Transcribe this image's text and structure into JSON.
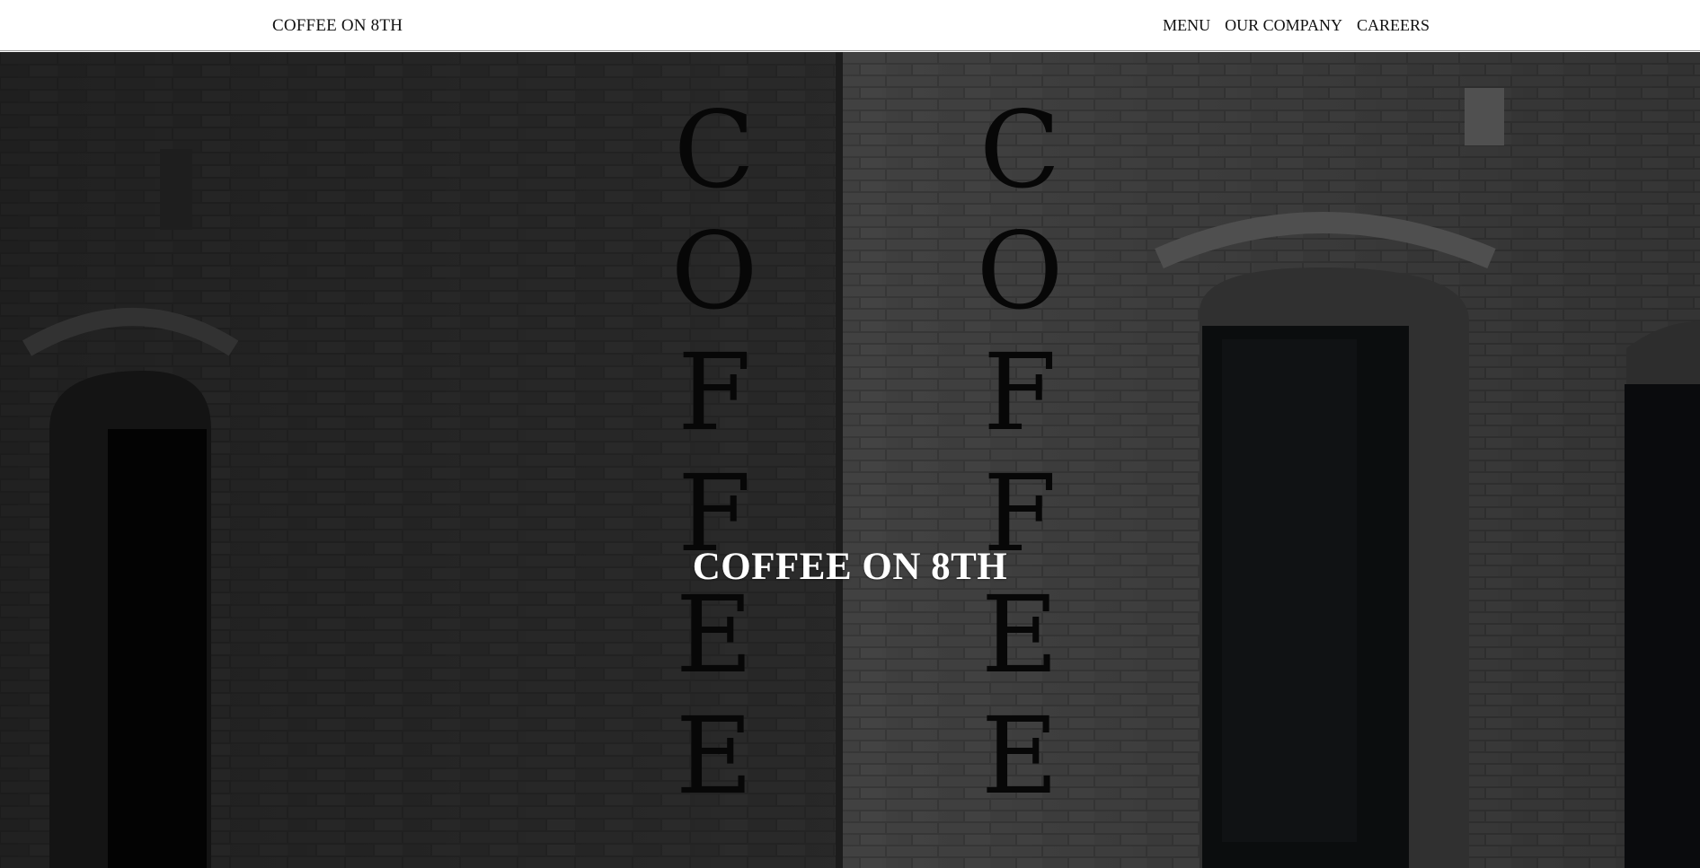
{
  "header": {
    "brand": "COFFEE ON 8TH",
    "nav": [
      {
        "label": "MENU"
      },
      {
        "label": "OUR COMPANY"
      },
      {
        "label": "CAREERS"
      }
    ]
  },
  "hero": {
    "title": "COFFEE ON 8TH",
    "background_image": "brick-building-corner-coffee-sign",
    "overlay": "dark"
  },
  "colors": {
    "header_bg": "#ffffff",
    "text_dark": "#111111",
    "hero_text": "#ffffff"
  }
}
